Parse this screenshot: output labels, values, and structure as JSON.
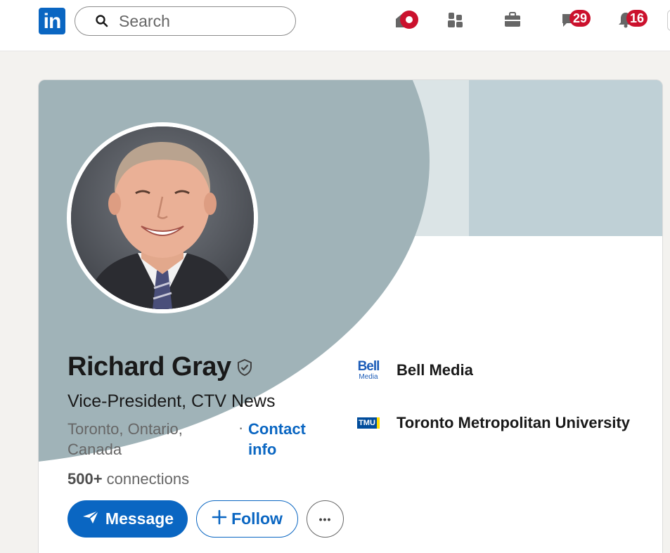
{
  "nav": {
    "logo_text": "in",
    "search_placeholder": "Search",
    "messaging_count": "29",
    "notifications_count": "16",
    "icons": [
      "home-icon",
      "my-network-icon",
      "jobs-icon",
      "messaging-icon",
      "notifications-icon"
    ]
  },
  "profile": {
    "name": "Richard Gray",
    "headline": "Vice-President, CTV News",
    "location": "Toronto, Ontario, Canada",
    "separator": "·",
    "contact_info": "Contact info",
    "connections_count": "500+",
    "connections_label": " connections",
    "actions": {
      "message": "Message",
      "follow": "Follow",
      "more": "•••"
    },
    "companies": [
      {
        "name": "Bell Media",
        "logo_line1": "Bell",
        "logo_line2": "Media"
      },
      {
        "name": "Toronto Metropolitan University",
        "logo_text": "TMU"
      }
    ]
  },
  "colors": {
    "brand": "#0a66c2",
    "badge": "#cb112d",
    "banner_dark": "#a0b3b8",
    "banner_light": "#bfd0d6"
  }
}
